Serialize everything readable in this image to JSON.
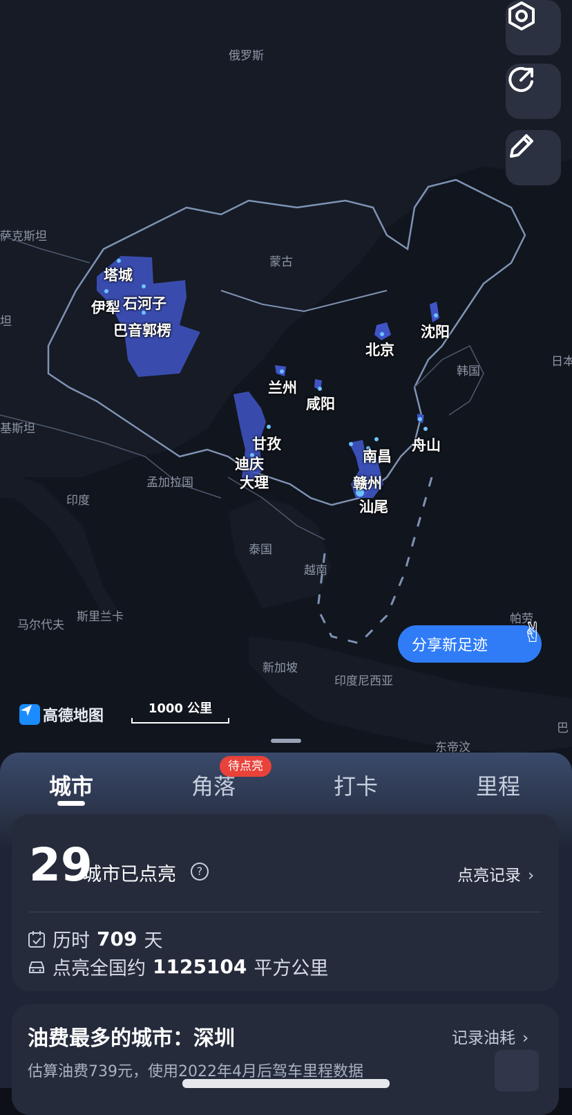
{
  "map": {
    "countries": [
      "俄罗斯",
      "蒙古",
      "萨克斯坦",
      "坦",
      "基斯坦",
      "韩国",
      "日本",
      "印度",
      "孟加拉国",
      "泰国",
      "越南",
      "马尔代夫",
      "斯里兰卡",
      "新加坡",
      "印度尼西亚",
      "帕劳",
      "东帝汶",
      "巴"
    ],
    "cities": [
      "塔城",
      "伊犁",
      "石河子",
      "巴音郭楞",
      "北京",
      "沈阳",
      "兰州",
      "咸阳",
      "甘孜",
      "迪庆",
      "大理",
      "舟山",
      "南昌",
      "赣州",
      "汕尾"
    ],
    "logo_text": "高德地图",
    "scale_label": "1000 公里",
    "share_button": "分享新足迹"
  },
  "toolbar": {
    "settings_icon": "settings-hexagon-icon",
    "share_icon": "share-arrow-icon",
    "edit_icon": "pencil-icon"
  },
  "tabs": [
    {
      "label": "城市",
      "active": true
    },
    {
      "label": "角落",
      "badge": "待点亮"
    },
    {
      "label": "打卡"
    },
    {
      "label": "里程"
    }
  ],
  "summary": {
    "count": "29",
    "count_label": "城市已点亮",
    "help": "?",
    "record_link": "点亮记录",
    "duration_prefix": "历时",
    "duration_value": "709",
    "duration_unit": "天",
    "area_prefix": "点亮全国约",
    "area_value": "1125104",
    "area_unit": "平方公里"
  },
  "fuel": {
    "title": "油费最多的城市：深圳",
    "link": "记录油耗",
    "subtitle": "估算油费739元，使用2022年4月后驾车里程数据"
  },
  "colors": {
    "accent": "#2f7cf6",
    "highlight": "#3f5bd6",
    "badge": "#e8423a"
  }
}
